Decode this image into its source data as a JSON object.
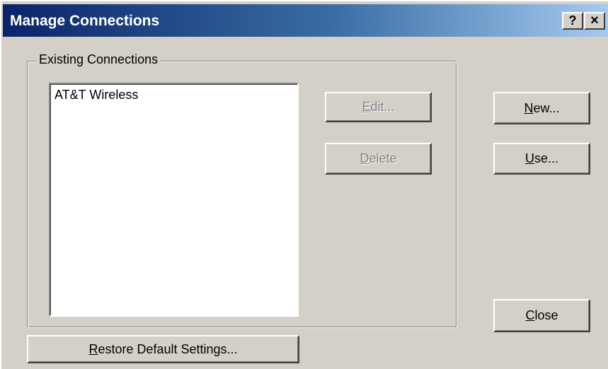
{
  "window": {
    "title": "Manage Connections",
    "help_button": "?",
    "close_button": "×"
  },
  "group": {
    "label": "Existing Connections",
    "connections": [
      "AT&T Wireless"
    ]
  },
  "buttons": {
    "edit": {
      "accel": "E",
      "rest": "dit...",
      "enabled": false
    },
    "delete": {
      "accel": "D",
      "rest": "elete",
      "enabled": false
    },
    "new": {
      "accel": "N",
      "rest": "ew...",
      "enabled": true
    },
    "use": {
      "accel": "U",
      "rest": "se...",
      "enabled": true
    },
    "close": {
      "accel": "C",
      "rest": "lose",
      "enabled": true
    },
    "restore": {
      "accel": "R",
      "rest": "estore Default Settings...",
      "enabled": true
    }
  },
  "colors": {
    "title_start": "#0a246a",
    "title_end": "#a6caf0",
    "face": "#d4d0c8"
  }
}
